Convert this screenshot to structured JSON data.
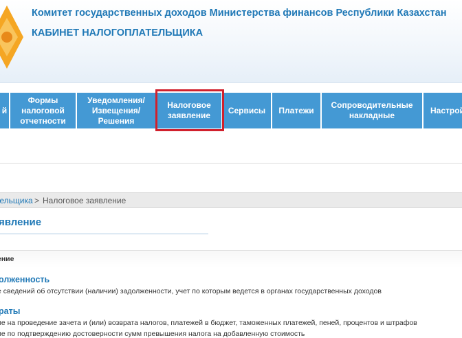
{
  "header": {
    "org_name": "Комитет государственных доходов Министерства финансов Республики Казахстан",
    "cabinet_title": "КАБИНЕТ НАЛОГОПЛАТЕЛЬЩИКА"
  },
  "nav": {
    "items": [
      {
        "label": "й"
      },
      {
        "label": "Формы налоговой отчетности"
      },
      {
        "label": "Уведомления/ Извещения/ Решения"
      },
      {
        "label": "Налоговое заявление"
      },
      {
        "label": "Сервисы"
      },
      {
        "label": "Платежи"
      },
      {
        "label": "Сопроводительные накладные"
      },
      {
        "label": "Настрой"
      }
    ],
    "active_color": "#4499d4",
    "highlight_color": "#d1202c"
  },
  "breadcrumb": {
    "link": "тельщика",
    "separator": ">",
    "current": "Налоговое заявление"
  },
  "page": {
    "title": "явление"
  },
  "section": {
    "label": "ение"
  },
  "services": [
    {
      "title": "олженность",
      "description": "е сведений об отсутствии (наличии) задолженности, учет по которым ведется в органах государственных доходов"
    },
    {
      "title": "раты",
      "description": "ие на проведение зачета и (или) возврата налогов, платежей в бюджет, таможенных платежей, пеней, процентов и штрафов",
      "description2": "ие по подтверждению достоверности сумм превышения налога на добавленную стоимость"
    }
  ]
}
